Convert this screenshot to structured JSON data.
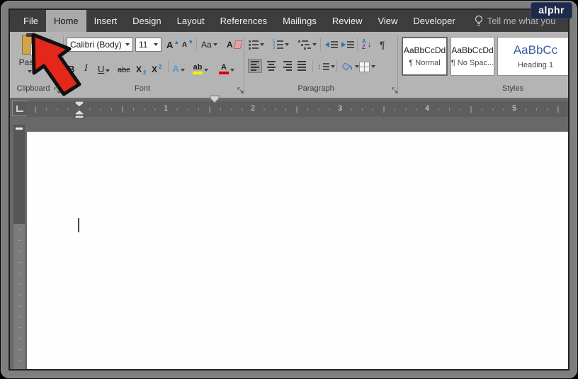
{
  "window": {
    "badge": "alphr"
  },
  "menubar": {
    "tabs": [
      {
        "label": "File"
      },
      {
        "label": "Home"
      },
      {
        "label": "Insert"
      },
      {
        "label": "Design"
      },
      {
        "label": "Layout"
      },
      {
        "label": "References"
      },
      {
        "label": "Mailings"
      },
      {
        "label": "Review"
      },
      {
        "label": "View"
      },
      {
        "label": "Developer"
      }
    ],
    "active_tab": "Home",
    "tell_me": "Tell me what you"
  },
  "ribbon": {
    "clipboard": {
      "paste": "Paste",
      "group_label": "Clipboard"
    },
    "font": {
      "family": "Calibri (Body)",
      "size": "11",
      "grow": "A",
      "shrink": "A",
      "change_case": "Aa",
      "clear_format": "A",
      "bold": "B",
      "italic": "I",
      "underline": "U",
      "strikethrough": "abc",
      "sub_base": "X",
      "sub_digit": "2",
      "sup_base": "X",
      "sup_digit": "2",
      "text_effects": "A",
      "highlight": "ab",
      "font_color": "A",
      "group_label": "Font"
    },
    "paragraph": {
      "sort_a": "A",
      "sort_z": "Z",
      "sort_arrow": "↓",
      "spacing_arrow": "↕",
      "pilcrow": "¶",
      "group_label": "Paragraph"
    },
    "styles": {
      "cards": [
        {
          "sample": "AaBbCcDd",
          "label": "¶ Normal"
        },
        {
          "sample": "AaBbCcDd",
          "label": "¶ No Spac..."
        },
        {
          "sample": "AaBbCc",
          "label": "Heading 1"
        }
      ],
      "group_label": "Styles"
    }
  },
  "ruler": {
    "numbers": [
      "1",
      "2",
      "3",
      "4",
      "5"
    ]
  },
  "icons": {
    "scissors": "✂"
  },
  "colors": {
    "accent_blue": "#2e75b6",
    "heading_blue": "#3f5e9e",
    "highlight_yellow": "#f8ef00",
    "font_color_red": "#e00000",
    "arrow_red": "#e5261b",
    "badge_navy": "#1d2a4a"
  }
}
